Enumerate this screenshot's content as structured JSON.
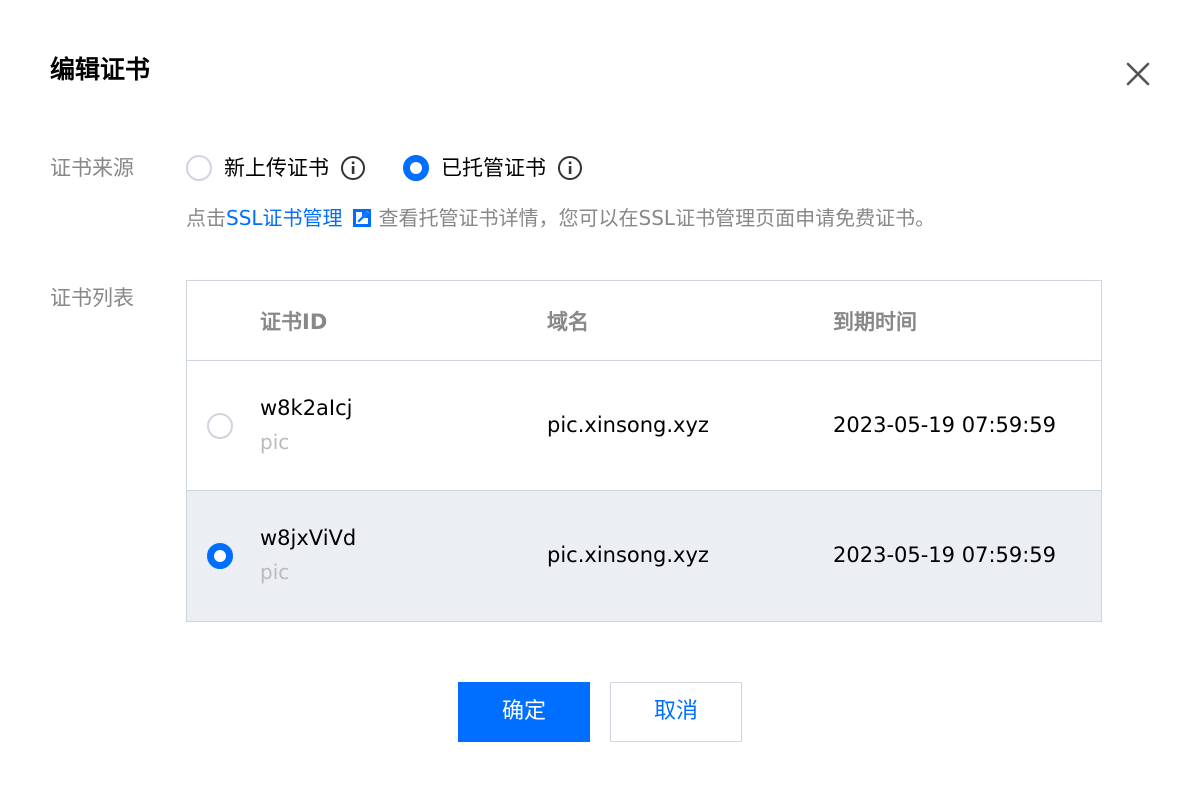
{
  "dialog": {
    "title": "编辑证书"
  },
  "source": {
    "label": "证书来源",
    "options": [
      {
        "label": "新上传证书",
        "checked": false
      },
      {
        "label": "已托管证书",
        "checked": true
      }
    ],
    "hint_prefix": "点击",
    "hint_link": "SSL证书管理",
    "hint_suffix": "查看托管证书详情，您可以在SSL证书管理页面申请免费证书。"
  },
  "cert_list": {
    "label": "证书列表",
    "columns": [
      "证书ID",
      "域名",
      "到期时间"
    ],
    "rows": [
      {
        "id": "w8k2aIcj",
        "alias": "pic",
        "domain": "pic.xinsong.xyz",
        "expires": "2023-05-19 07:59:59",
        "selected": false
      },
      {
        "id": "w8jxViVd",
        "alias": "pic",
        "domain": "pic.xinsong.xyz",
        "expires": "2023-05-19 07:59:59",
        "selected": true
      }
    ]
  },
  "footer": {
    "confirm": "确定",
    "cancel": "取消"
  },
  "colors": {
    "accent": "#006eff",
    "selected_row_bg": "#ebeef2",
    "border": "#cfd5de",
    "muted_text": "#888888"
  },
  "icons": [
    "close-icon",
    "info-icon",
    "external-link-icon"
  ]
}
